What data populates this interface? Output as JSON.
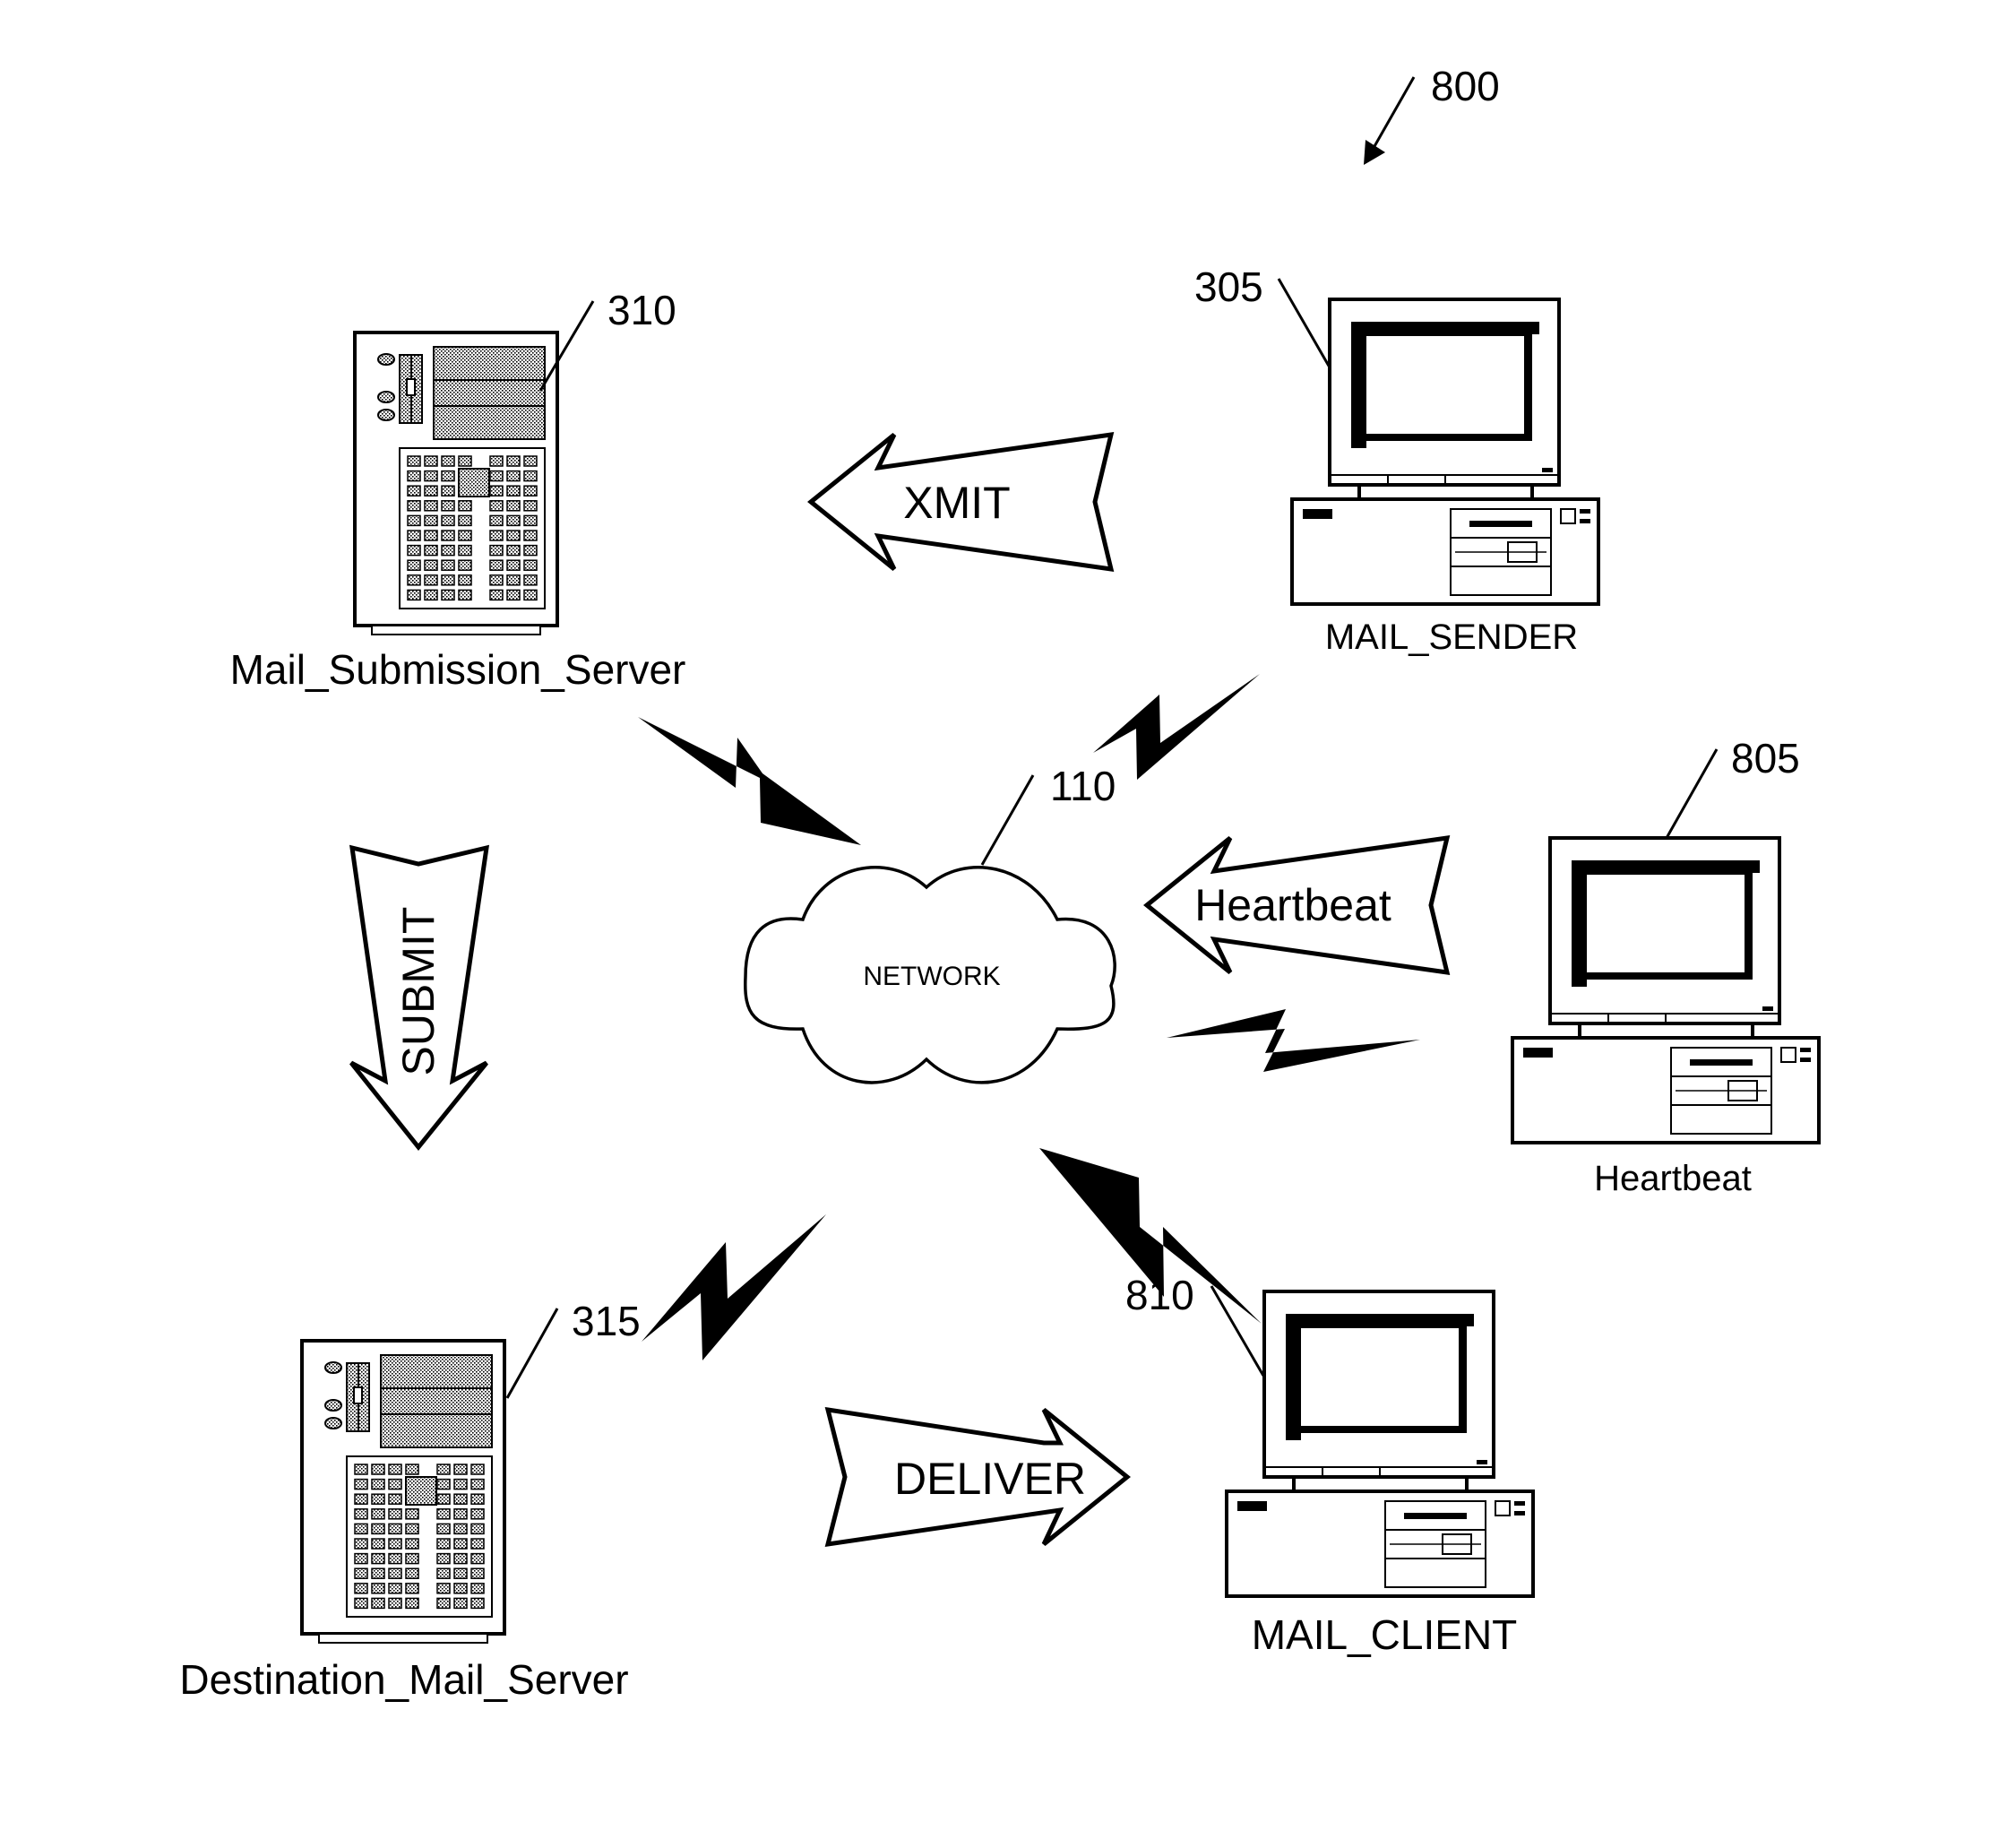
{
  "figure": {
    "reference_number": "800",
    "network": {
      "label": "NETWORK",
      "ref": "110"
    },
    "nodes": {
      "mail_submission_server": {
        "label": "Mail_Submission_Server",
        "ref": "310",
        "type": "server"
      },
      "destination_mail_server": {
        "label": "Destination_Mail_Server",
        "ref": "315",
        "type": "server"
      },
      "mail_sender": {
        "label": "MAIL_SENDER",
        "ref": "305",
        "type": "computer"
      },
      "heartbeat": {
        "label": "Heartbeat",
        "ref": "805",
        "type": "computer"
      },
      "mail_client": {
        "label": "MAIL_CLIENT",
        "ref": "810",
        "type": "computer"
      }
    },
    "flows": {
      "xmit": {
        "label": "XMIT",
        "from": "MAIL_SENDER",
        "to": "Mail_Submission_Server",
        "direction": "left"
      },
      "submit": {
        "label": "SUBMIT",
        "from": "Mail_Submission_Server",
        "to": "Destination_Mail_Server",
        "direction": "down"
      },
      "deliver": {
        "label": "DELIVER",
        "from": "Destination_Mail_Server",
        "to": "MAIL_CLIENT",
        "direction": "right"
      },
      "heartbeat": {
        "label": "Heartbeat",
        "from": "Heartbeat",
        "to": "NETWORK",
        "direction": "left"
      }
    },
    "links": [
      "lightning-bolt-icon",
      "lightning-bolt-icon",
      "lightning-bolt-icon",
      "lightning-bolt-icon",
      "lightning-bolt-icon"
    ],
    "colors": {
      "ink": "#000000",
      "paper": "#ffffff"
    }
  }
}
